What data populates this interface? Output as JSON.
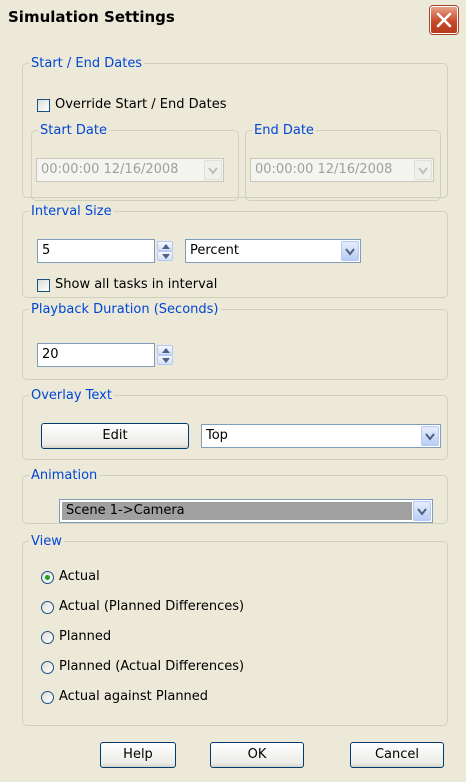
{
  "window": {
    "title": "Simulation Settings"
  },
  "start_end": {
    "legend": "Start / End Dates",
    "override_label": "Override Start / End Dates",
    "override_checked": false,
    "start": {
      "legend": "Start Date",
      "value": "00:00:00 12/16/2008"
    },
    "end": {
      "legend": "End Date",
      "value": "00:00:00 12/16/2008"
    }
  },
  "interval": {
    "legend": "Interval Size",
    "value": "5",
    "unit": "Percent",
    "show_all_label": "Show all tasks in interval",
    "show_all_checked": false
  },
  "playback": {
    "legend": "Playback Duration (Seconds)",
    "value": "20"
  },
  "overlay": {
    "legend": "Overlay Text",
    "edit_label": "Edit",
    "position": "Top"
  },
  "animation": {
    "legend": "Animation",
    "value": "Scene 1->Camera"
  },
  "view": {
    "legend": "View",
    "options": [
      "Actual",
      "Actual (Planned Differences)",
      "Planned",
      "Planned (Actual Differences)",
      "Actual against Planned"
    ],
    "selected": "Actual"
  },
  "buttons": {
    "help": "Help",
    "ok": "OK",
    "cancel": "Cancel"
  },
  "icons": {
    "close": "close-icon",
    "dropdown": "chevron-down-icon",
    "spin_up": "arrow-up-icon",
    "spin_down": "arrow-down-icon"
  }
}
